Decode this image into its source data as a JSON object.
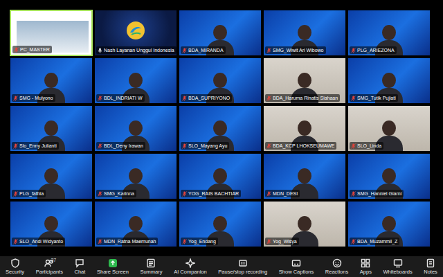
{
  "tiles": [
    {
      "name": "PC_MASTER",
      "muted": true,
      "active": true,
      "kind": "slide"
    },
    {
      "name": "Nash Layanan Unggul Indonesia",
      "muted": false,
      "active": false,
      "kind": "logo"
    },
    {
      "name": "BDA_MIRANDA",
      "muted": true,
      "active": false,
      "kind": "branded"
    },
    {
      "name": "SMG_Wiwit Ari Wibowo",
      "muted": true,
      "active": false,
      "kind": "branded"
    },
    {
      "name": "PLG_ARIEZONA",
      "muted": true,
      "active": false,
      "kind": "branded"
    },
    {
      "name": "SMG - Mulyono",
      "muted": true,
      "active": false,
      "kind": "branded"
    },
    {
      "name": "BDL_INDRIATI W",
      "muted": true,
      "active": false,
      "kind": "branded"
    },
    {
      "name": "BDA_SUPRIYONO",
      "muted": true,
      "active": false,
      "kind": "branded"
    },
    {
      "name": "BDA_Haruma Rinatis Siahaan",
      "muted": true,
      "active": false,
      "kind": "camera"
    },
    {
      "name": "SMG_Tutik Pujiati",
      "muted": true,
      "active": false,
      "kind": "branded"
    },
    {
      "name": "Slo_Enny Julianti",
      "muted": true,
      "active": false,
      "kind": "branded"
    },
    {
      "name": "BDL_Deny Irawan",
      "muted": true,
      "active": false,
      "kind": "branded"
    },
    {
      "name": "SLO_Mayang Ayu",
      "muted": true,
      "active": false,
      "kind": "branded"
    },
    {
      "name": "BDA_KCP LHOKSEUMAWE",
      "muted": true,
      "active": false,
      "kind": "camera"
    },
    {
      "name": "SLO_Linda",
      "muted": true,
      "active": false,
      "kind": "camera"
    },
    {
      "name": "PLG_fathia",
      "muted": true,
      "active": false,
      "kind": "branded"
    },
    {
      "name": "SMG_Karinna",
      "muted": true,
      "active": false,
      "kind": "branded"
    },
    {
      "name": "YOG_RAIS BACHTIAR",
      "muted": true,
      "active": false,
      "kind": "branded"
    },
    {
      "name": "MDN_DESI",
      "muted": true,
      "active": false,
      "kind": "branded"
    },
    {
      "name": "SMG_Hanniel Giarni",
      "muted": true,
      "active": false,
      "kind": "branded"
    },
    {
      "name": "SLO_Andi Widyanto",
      "muted": true,
      "active": false,
      "kind": "branded"
    },
    {
      "name": "MDN_Ratna Maemunah",
      "muted": true,
      "active": false,
      "kind": "branded"
    },
    {
      "name": "Yog_Endang",
      "muted": true,
      "active": false,
      "kind": "branded"
    },
    {
      "name": "Yog_Wisya",
      "muted": true,
      "active": false,
      "kind": "camera"
    },
    {
      "name": "BDA_Muzammil_Z",
      "muted": true,
      "active": false,
      "kind": "branded"
    }
  ],
  "toolbar": [
    {
      "label": "Security"
    },
    {
      "label": "Participants",
      "count": "37"
    },
    {
      "label": "Chat"
    },
    {
      "label": "Share Screen"
    },
    {
      "label": "Summary"
    },
    {
      "label": "AI Companion"
    },
    {
      "label": "Pause/stop recording"
    },
    {
      "label": "Show Captions"
    },
    {
      "label": "Reactions"
    },
    {
      "label": "Apps"
    },
    {
      "label": "Whiteboards"
    },
    {
      "label": "Notes"
    }
  ]
}
